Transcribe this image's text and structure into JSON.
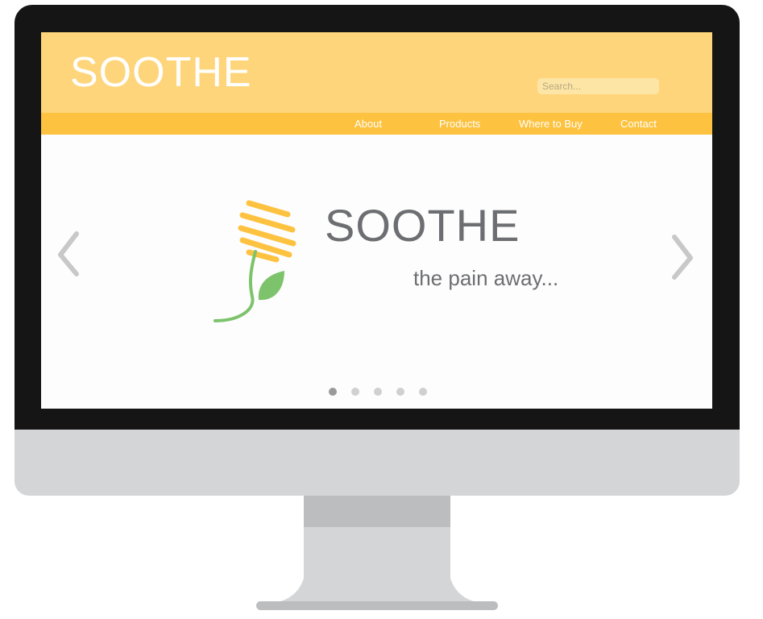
{
  "header": {
    "brand": "SOOTHE",
    "search_placeholder": "Search..."
  },
  "nav": {
    "items": [
      {
        "label": "About"
      },
      {
        "label": "Products"
      },
      {
        "label": "Where to Buy"
      },
      {
        "label": "Contact"
      }
    ]
  },
  "hero": {
    "title": "SOOTHE",
    "tagline": "the pain away...",
    "slide_count": 5,
    "active_slide": 1
  },
  "colors": {
    "header_bg": "#fed57a",
    "nav_bg": "#fdc23f",
    "logo_yellow": "#fdc23f",
    "logo_green": "#7dc36b",
    "text_gray": "#6d6e71"
  },
  "icons": {
    "prev": "chevron-left-icon",
    "next": "chevron-right-icon",
    "logo": "flower-logo-icon"
  }
}
